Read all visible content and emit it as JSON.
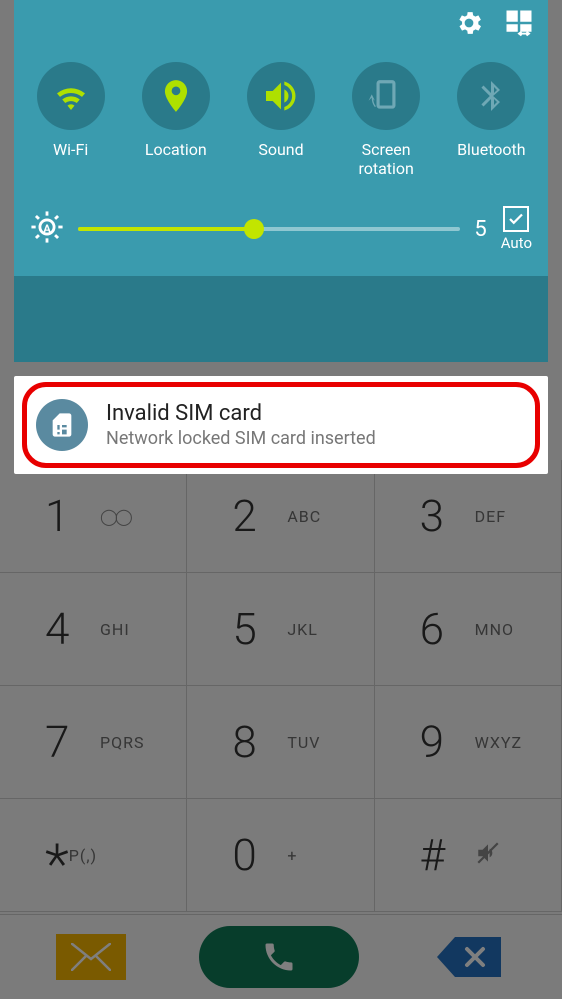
{
  "quickSettings": {
    "toggles": [
      {
        "label": "Wi-Fi",
        "active": true
      },
      {
        "label": "Location",
        "active": true
      },
      {
        "label": "Sound",
        "active": true
      },
      {
        "label": "Screen\nrotation",
        "active": false
      },
      {
        "label": "Bluetooth",
        "active": false
      }
    ],
    "brightness": {
      "value": "5",
      "percent": 46,
      "autoLabel": "Auto",
      "autoChecked": true
    }
  },
  "notification": {
    "title": "Invalid SIM card",
    "subtitle": "Network locked SIM card inserted"
  },
  "dialer": {
    "keys": [
      {
        "digit": "1",
        "letters": "",
        "voicemail": true
      },
      {
        "digit": "2",
        "letters": "ABC"
      },
      {
        "digit": "3",
        "letters": "DEF"
      },
      {
        "digit": "4",
        "letters": "GHI"
      },
      {
        "digit": "5",
        "letters": "JKL"
      },
      {
        "digit": "6",
        "letters": "MNO"
      },
      {
        "digit": "7",
        "letters": "PQRS"
      },
      {
        "digit": "8",
        "letters": "TUV"
      },
      {
        "digit": "9",
        "letters": "WXYZ"
      },
      {
        "digit": "*",
        "letters": "P(,)",
        "star": true
      },
      {
        "digit": "0",
        "letters": "+"
      },
      {
        "digit": "#",
        "letters": "",
        "hash": true,
        "mute": true
      }
    ]
  }
}
